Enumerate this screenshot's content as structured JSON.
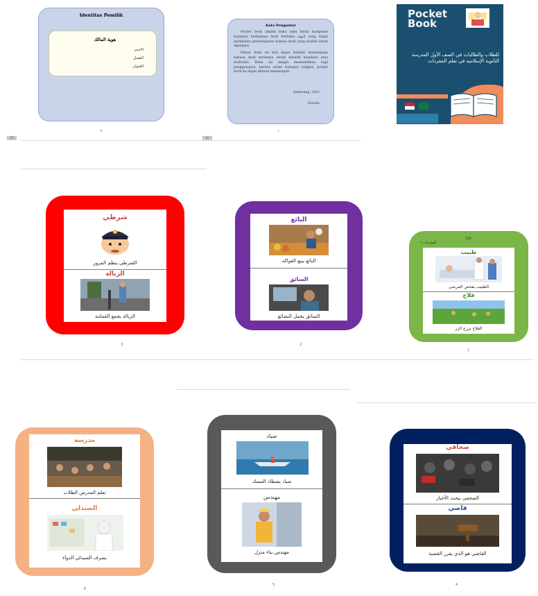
{
  "identity": {
    "title": "Identitas Pemilik",
    "heading": "هوية المالك",
    "fields": [
      "الاسم",
      "الفصل",
      "العنوان"
    ],
    "page_number": "ii"
  },
  "preface": {
    "title": "Kata Pengantar",
    "paragraphs": [
      "Pocket book adalah buku saku berisi kumpulan kosakata berbahasa Arab bertema المهنة yang dapat membantu pembelajaran bahasa Arab yang mudah untuk dipelajari.",
      "Dalam buku ini kita dapat melatih kemampuan bahasa Arab terutama untuk melatih kosakata atau mufradat. Buku ini sangat memudahkan bagi penggunanya, karena selain bukunya ringkas, pocket book ini dapat dibawa kemanapun."
    ],
    "place_date": "Semarang, 2021",
    "signature": "Penulis",
    "page_number": "i"
  },
  "badges": [
    "iii",
    "iv"
  ],
  "cover": {
    "title_line1": "Pocket",
    "title_line2": "Book",
    "subtitle": "للطلاب والطالبات في الصف الأول المدرسة الثانوية الإسلامية في تعلم المفردات"
  },
  "cards": [
    {
      "id": "police",
      "page": "3",
      "color": "#ff0000",
      "top_word": "شرطي",
      "top_caption": "الشرطي ينظم المرور",
      "bottom_word": "الزبالة",
      "bottom_caption": "الزبالة يجمع القمامة"
    },
    {
      "id": "seller",
      "page": "2",
      "color": "#7030a0",
      "top_word": "البائع",
      "top_caption": "البائع يبيع الفواكه",
      "bottom_word": "السائق",
      "bottom_caption": "السائق يحمل البضائع"
    },
    {
      "id": "doctor",
      "page": "1",
      "color": "#7ab648",
      "header_word": "المفردات ١",
      "header_label": "1st",
      "top_word": "طبيب",
      "top_caption": "الطبيب يفحص المرضى",
      "bottom_word": "فلاح",
      "bottom_caption": "الفلاح يزرع الرز"
    },
    {
      "id": "school",
      "page": "6",
      "color": "#f4b183",
      "top_word": "مدرسة",
      "top_caption": "تعلم المدرس الطلاب",
      "bottom_word": "الصيدلي",
      "bottom_caption": "يصرف الصيدلي الدواء"
    },
    {
      "id": "fisher",
      "page": "5",
      "color": "#595959",
      "top_word": "صياد",
      "top_caption": "صياد يصطاد السمك",
      "bottom_word": "مهندس",
      "bottom_caption": "مهندس بناء منزل"
    },
    {
      "id": "journalist",
      "page": "4",
      "color": "#002060",
      "top_word": "صحافي",
      "top_caption": "الصحفي يبحث الأخبار",
      "bottom_word": "قاضي",
      "bottom_caption": "القاضي هو الذي يقرر القضية"
    }
  ],
  "colors": {
    "word_color": "#c0504d",
    "word_color_green": "#3a8a2a",
    "word_color_orange": "#e07b39"
  }
}
